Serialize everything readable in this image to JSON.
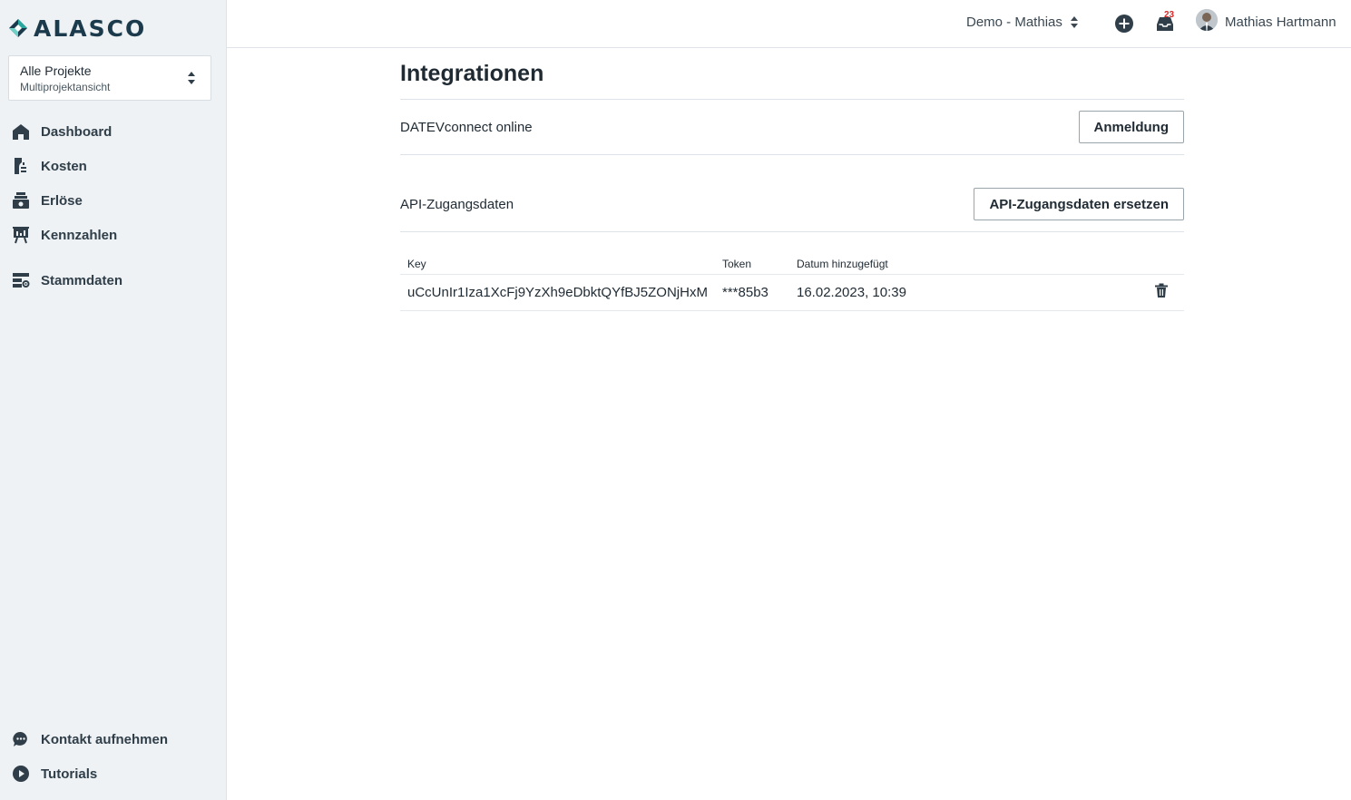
{
  "app": {
    "logo_text": "ALASCO"
  },
  "project_selector": {
    "title": "Alle Projekte",
    "subtitle": "Multiprojektansicht"
  },
  "sidebar": {
    "items": [
      {
        "label": "Dashboard",
        "icon": "home-icon"
      },
      {
        "label": "Kosten",
        "icon": "costs-icon"
      },
      {
        "label": "Erlöse",
        "icon": "revenue-icon"
      },
      {
        "label": "Kennzahlen",
        "icon": "chart-icon"
      },
      {
        "label": "Stammdaten",
        "icon": "master-data-icon"
      }
    ],
    "bottom": [
      {
        "label": "Kontakt aufnehmen",
        "icon": "chat-icon"
      },
      {
        "label": "Tutorials",
        "icon": "play-icon"
      }
    ]
  },
  "topbar": {
    "tenant": "Demo - Mathias",
    "notification_count": "23",
    "user_name": "Mathias Hartmann"
  },
  "page": {
    "title": "Integrationen",
    "datev": {
      "label": "DATEVconnect online",
      "button": "Anmeldung"
    },
    "api": {
      "label": "API-Zugangsdaten",
      "button": "API-Zugangsdaten ersetzen"
    },
    "table": {
      "headers": [
        "Key",
        "Token",
        "Datum hinzugefügt"
      ],
      "rows": [
        {
          "key": "uCcUnIr1Iza1XcFj9YzXh9eDbktQYfBJ5ZONjHxM",
          "token": "***85b3",
          "date": "16.02.2023, 10:39"
        }
      ]
    }
  },
  "colors": {
    "sidebar_bg": "#eef2f5",
    "brand": "#1b3a4b",
    "accent_teal": "#2aa8a0",
    "badge": "#d62b2b"
  }
}
